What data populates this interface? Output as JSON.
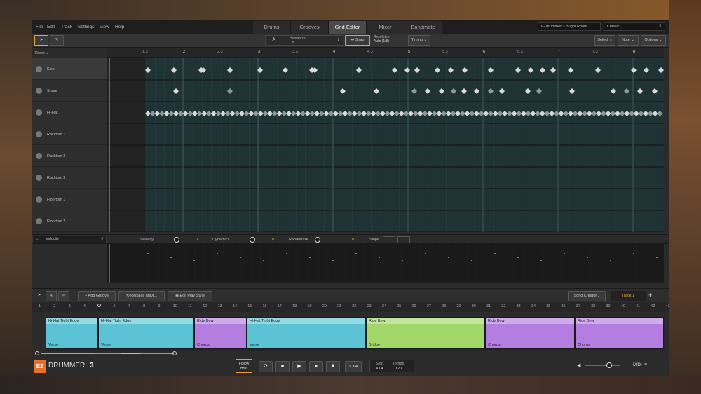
{
  "menu": [
    "File",
    "Edit",
    "Track",
    "Settings",
    "View",
    "Help"
  ],
  "tabs": [
    "Drums",
    "Grooves",
    "Grid Editor",
    "Mixer",
    "Bandmate"
  ],
  "active_tab": "Grid Editor",
  "kit_select": "EZdrummer 3 Bright Room",
  "style_select": "Classic",
  "toolbar": {
    "humanize_label": "Humanize",
    "humanize_value": "Off",
    "snap_label": "Snap",
    "resolution_label": "Resolution",
    "resolution_value": "Auto (1/8)",
    "timing_label": "Timing",
    "select_label": "Select",
    "note_label": "Note",
    "options_label": "Options"
  },
  "rows_label": "Rows",
  "rows": [
    "Kick",
    "Snare",
    "Hi-Hat",
    "Racktom 1",
    "Racktom 2",
    "Racktom 3",
    "Floortom 1",
    "Floortom 2"
  ],
  "ruler": [
    "1.3",
    "2",
    "2.3",
    "3",
    "3.3",
    "4",
    "4.3",
    "5",
    "5.3",
    "6",
    "6.3",
    "7",
    "7.3",
    "8"
  ],
  "velocity": {
    "lane_select": "Velocity",
    "velocity_label": "Velocity",
    "velocity_value": "0",
    "dynamics_label": "Dynamics",
    "dynamics_value": "0",
    "randomize_label": "Randomize",
    "randomize_value": "0",
    "slope_label": "Slope"
  },
  "song_toolbar": {
    "add_groove": "Add Groove",
    "replace_midi": "Replace MIDI...",
    "edit_play_style": "Edit Play Style",
    "song_creator": "Song Creator",
    "track_label": "Track 1",
    "add_icon": "+"
  },
  "song_ruler": [
    "1",
    "2",
    "3",
    "4",
    "5",
    "6",
    "7",
    "8",
    "9",
    "10",
    "11",
    "12",
    "13",
    "14",
    "15",
    "16",
    "17",
    "18",
    "19",
    "20",
    "21",
    "22",
    "23",
    "24",
    "25",
    "26",
    "27",
    "28",
    "29",
    "30",
    "31",
    "32",
    "33",
    "34",
    "35",
    "36",
    "37",
    "38",
    "39",
    "40",
    "41",
    "42",
    "43"
  ],
  "clips": [
    {
      "title": "Hi-Hat Tight Edge",
      "part": "Verse",
      "color": "#5bc3d3"
    },
    {
      "title": "Hi-Hat Tight Edge",
      "part": "Verse",
      "color": "#5bc3d3"
    },
    {
      "title": "Ride Bow",
      "part": "Chorus",
      "color": "#b47ee0"
    },
    {
      "title": "Hi-Hat Tight Edge",
      "part": "Verse",
      "color": "#5bc3d3"
    },
    {
      "title": "Ride Bow",
      "part": "Bridge",
      "color": "#a2d86a"
    },
    {
      "title": "Ride Bow",
      "part": "Chorus",
      "color": "#b47ee0"
    },
    {
      "title": "Ride Bow",
      "part": "Chorus",
      "color": "#b47ee0"
    }
  ],
  "transport": {
    "logo_ez": "EZ",
    "logo_name": "DRUMMER",
    "logo_num": "3",
    "follow_host": "Follow Host",
    "count_in": "≥ 3 4",
    "sign_label": "Sign.",
    "sign_value": "4 / 4",
    "tempo_label": "Tempo",
    "tempo_value": "120",
    "midi_label": "MIDI"
  },
  "colors": {
    "accent": "#e8a030",
    "grid": "#1f3234",
    "hits": "#c8c8c8"
  }
}
